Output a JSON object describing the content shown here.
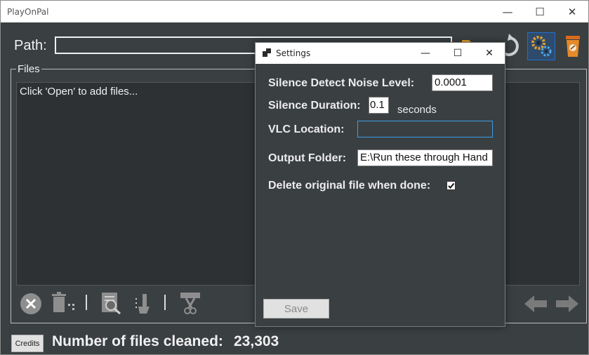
{
  "app": {
    "title": "PlayOnPal",
    "window_controls": {
      "minimize": "—",
      "maximize": "☐",
      "close": "✕"
    }
  },
  "path": {
    "label": "Path:",
    "value": ""
  },
  "files": {
    "legend": "Files",
    "hint": "Click 'Open' to add files..."
  },
  "footer": {
    "credits_label": "Credits",
    "count_label": "Number of files cleaned:",
    "count_value": "23,303"
  },
  "toolbar_icons": [
    "folder-icon",
    "refresh-icon",
    "settings-gears-icon",
    "coffee-icon",
    "remove-icon",
    "trash-icon",
    "inspect-file-icon",
    "hand-sort-icon",
    "cut-icon",
    "arrow-left-icon",
    "arrow-right-icon"
  ],
  "settings_dialog": {
    "title": "Settings",
    "window_controls": {
      "minimize": "—",
      "maximize": "☐",
      "close": "✕"
    },
    "noise_level": {
      "label": "Silence Detect Noise Level:",
      "value": "0.0001"
    },
    "duration": {
      "label": "Silence Duration:",
      "value": "0.1",
      "unit": "seconds"
    },
    "vlc_location": {
      "label": "VLC Location:",
      "value": ""
    },
    "output_folder": {
      "label": "Output Folder:",
      "value": "E:\\Run these through Hand"
    },
    "delete_original": {
      "label": "Delete original file when done:",
      "checked": true
    },
    "save_label": "Save"
  },
  "colors": {
    "window_bg": "#3a3f42",
    "list_bg": "#2d3134",
    "text": "#f0f0f0",
    "accent_focus": "#3c9ee8",
    "settings_active_border": "#1f6fd1"
  }
}
